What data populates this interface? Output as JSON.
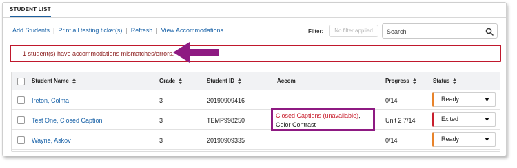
{
  "tab": {
    "label": "STUDENT LIST"
  },
  "actions": {
    "add_students": "Add Students",
    "print_tickets": "Print all testing ticket(s)",
    "refresh": "Refresh",
    "view_accommodations": "View Accommodations",
    "separator": "|"
  },
  "filter": {
    "label": "Filter:",
    "value": "No filter applied"
  },
  "search": {
    "placeholder": "Search",
    "icon": "search-icon"
  },
  "alert": {
    "message": "1 student(s) have accommodations mismatches/errors.",
    "border_color": "#c0182d"
  },
  "annotation": {
    "arrow_color": "#8e1a82",
    "box_color": "#8e1a82"
  },
  "table": {
    "columns": {
      "name": "Student Name",
      "grade": "Grade",
      "student_id": "Student ID",
      "accom": "Accom",
      "progress": "Progress",
      "status": "Status"
    },
    "rows": [
      {
        "name": "Ireton, Colma",
        "grade": "3",
        "student_id": "20190909416",
        "accom_strike": "",
        "accom_text": "",
        "progress": "0/14",
        "status": "Ready",
        "status_color": "#e8832a"
      },
      {
        "name": "Test One, Closed Caption",
        "grade": "3",
        "student_id": "TEMP998250",
        "accom_strike": "Closed Captions (unavailable)",
        "accom_text": ", Color Contrast",
        "progress": "Unit 2 7/14",
        "status": "Exited",
        "status_color": "#c81e2d"
      },
      {
        "name": "Wayne, Askov",
        "grade": "3",
        "student_id": "20190909335",
        "accom_strike": "",
        "accom_text": "",
        "progress": "0/14",
        "status": "Ready",
        "status_color": "#e8832a"
      }
    ]
  }
}
